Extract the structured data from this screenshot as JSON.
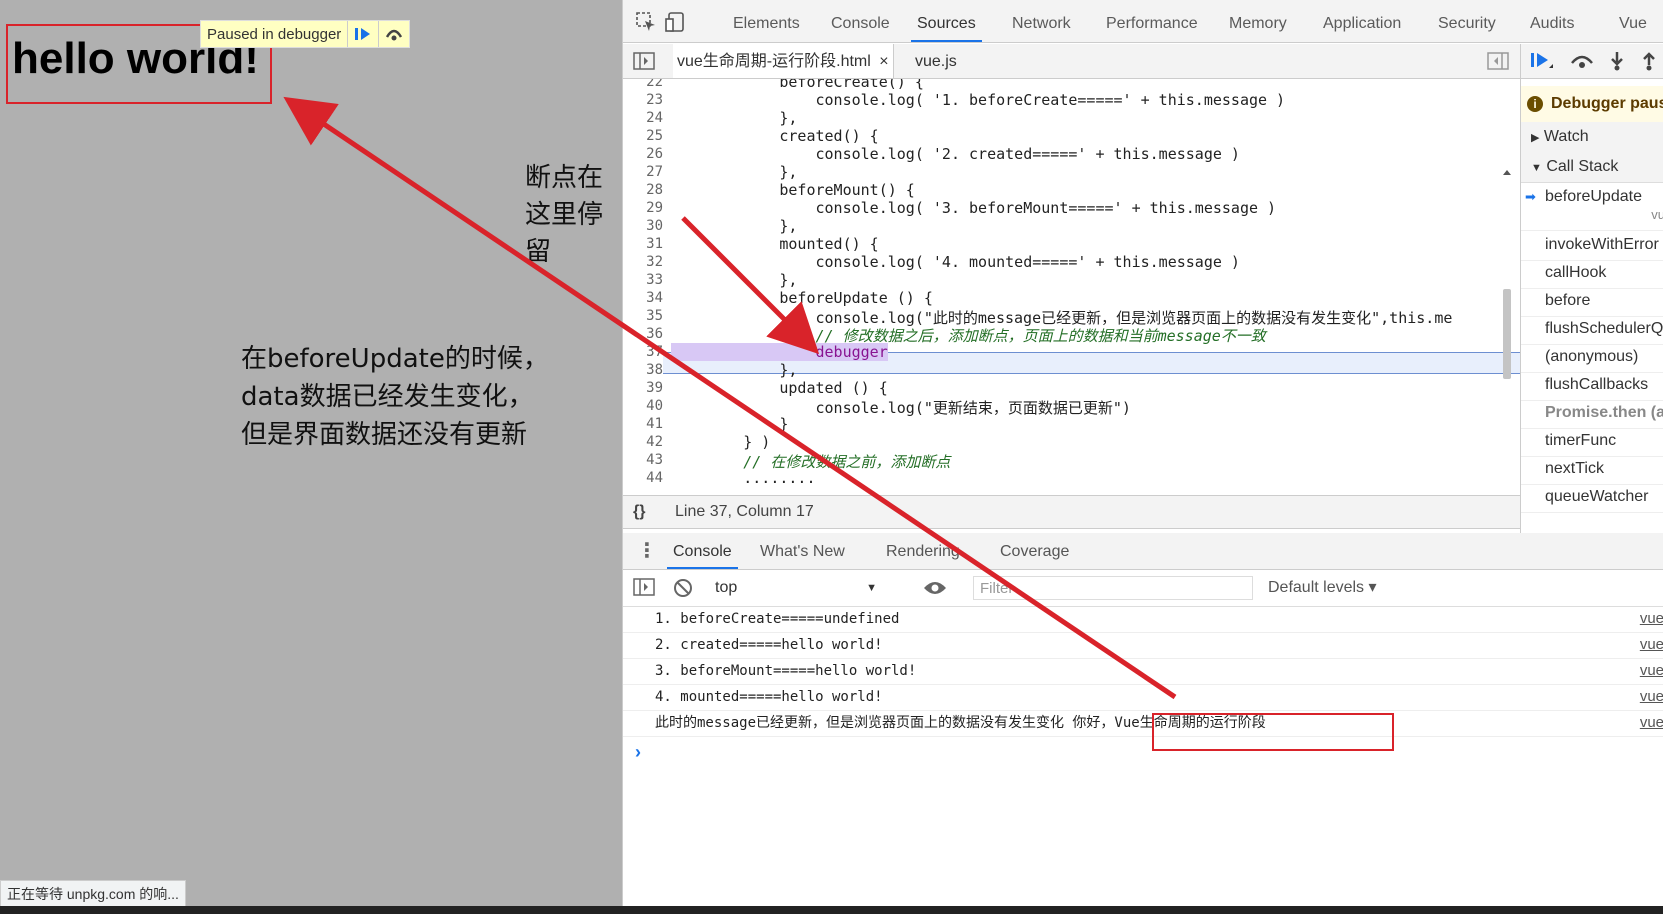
{
  "viewport": {
    "heading": "hello world!",
    "paused_label": "Paused in debugger",
    "note_left": [
      "在beforeUpdate的时候，",
      "data数据已经发生变化，",
      "但是界面数据还没有更新"
    ],
    "note_stop": "断点在这里停留",
    "status_text": "正在等待 unpkg.com 的响..."
  },
  "devtools": {
    "tabs": [
      "Elements",
      "Console",
      "Sources",
      "Network",
      "Performance",
      "Memory",
      "Application",
      "Security",
      "Audits",
      "Vue"
    ],
    "active_tab": "Sources",
    "file_tabs": [
      "vue生命周期-运行阶段.html",
      "vue.js"
    ],
    "file_tab_close": "×",
    "code_lines": [
      {
        "n": "22",
        "text": "            beforeCreate() {"
      },
      {
        "n": "23",
        "text": "                console.log( '1. beforeCreate=====' + this.message )"
      },
      {
        "n": "24",
        "text": "            },"
      },
      {
        "n": "25",
        "text": "            created() {"
      },
      {
        "n": "26",
        "text": "                console.log( '2. created=====' + this.message )"
      },
      {
        "n": "27",
        "text": "            },"
      },
      {
        "n": "28",
        "text": "            beforeMount() {"
      },
      {
        "n": "29",
        "text": "                console.log( '3. beforeMount=====' + this.message )"
      },
      {
        "n": "30",
        "text": "            },"
      },
      {
        "n": "31",
        "text": "            mounted() {"
      },
      {
        "n": "32",
        "text": "                console.log( '4. mounted=====' + this.message )"
      },
      {
        "n": "33",
        "text": "            },"
      },
      {
        "n": "34",
        "text": "            beforeUpdate () {"
      },
      {
        "n": "35",
        "text": "                console.log(\"此时的message已经更新，但是浏览器页面上的数据没有发生变化\",this.me"
      },
      {
        "n": "36",
        "text": "                // 修改数据之后，添加断点，页面上的数据和当前message不一致"
      },
      {
        "n": "37",
        "text": "                debugger"
      },
      {
        "n": "38",
        "text": "            },"
      },
      {
        "n": "39",
        "text": "            updated () {"
      },
      {
        "n": "40",
        "text": "                console.log(\"更新结束，页面数据已更新\")"
      },
      {
        "n": "41",
        "text": "            }"
      },
      {
        "n": "42",
        "text": "        } )"
      },
      {
        "n": "43",
        "text": "        // 在修改数据之前，添加断点"
      },
      {
        "n": "44",
        "text": "        ........"
      }
    ],
    "status_line": "Line 37, Column 17",
    "console_tabs": [
      "Console",
      "What's New",
      "Rendering",
      "Coverage"
    ],
    "console_context": "top",
    "filter_placeholder": "Filter",
    "default_levels": "Default levels ▾",
    "console_rows": [
      {
        "msg": "1. beforeCreate=====undefined",
        "src": "vue"
      },
      {
        "msg": "2. created=====hello world!",
        "src": "vue"
      },
      {
        "msg": "3. beforeMount=====hello world!",
        "src": "vue"
      },
      {
        "msg": "4. mounted=====hello world!",
        "src": "vue"
      },
      {
        "msg": "此时的message已经更新，但是浏览器页面上的数据没有发生变化 你好，Vue生命周期的运行阶段",
        "src": "vue"
      }
    ],
    "prompt_glyph": "›",
    "paused_banner": "Debugger paus",
    "watch_label": "Watch",
    "call_stack_label": "Call Stack",
    "call_stack": [
      "beforeUpdate",
      "invokeWithError",
      "callHook",
      "before",
      "flushSchedulerQ",
      "(anonymous)",
      "flushCallbacks",
      "Promise.then (a",
      "timerFunc",
      "nextTick",
      "queueWatcher"
    ],
    "call_stack_sub": "vu"
  },
  "colors": {
    "annotation_red": "#d9232a",
    "accent": "#1a73e8"
  }
}
